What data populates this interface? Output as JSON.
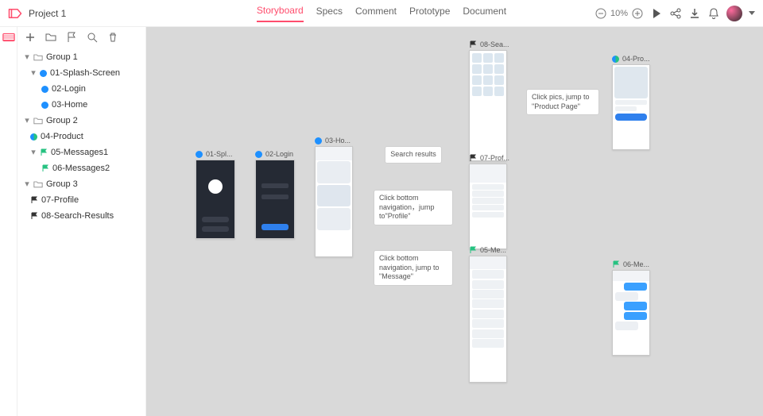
{
  "header": {
    "project_name": "Project 1",
    "tabs": {
      "storyboard": "Storyboard",
      "specs": "Specs",
      "comment": "Comment",
      "prototype": "Prototype",
      "document": "Document"
    },
    "zoom": "10%"
  },
  "sidebar": {
    "group1": {
      "label": "Group 1",
      "splash": "01-Splash-Screen",
      "login": "02-Login",
      "home": "03-Home"
    },
    "group2": {
      "label": "Group 2",
      "product": "04-Product",
      "messages1": "05-Messages1",
      "messages2": "06-Messages2"
    },
    "group3": {
      "label": "Group 3",
      "profile": "07-Profile",
      "search": "08-Search-Results"
    }
  },
  "nodes": {
    "splash": {
      "label": "01-Spl..."
    },
    "login": {
      "label": "02-Login"
    },
    "home": {
      "label": "03-Ho..."
    },
    "search": {
      "label": "08-Sea..."
    },
    "product": {
      "label": "04-Pro..."
    },
    "profile": {
      "label": "07-Prof..."
    },
    "messages1": {
      "label": "05-Me..."
    },
    "messages2": {
      "label": "06-Me..."
    }
  },
  "annotations": {
    "search_results": "Search results",
    "product_page": "Click pics, jump to \"Product Page\"",
    "profile": "Click bottom navigation，jump to\"Profile\"",
    "message": "Click bottom navigation, jump to \"Message\""
  }
}
